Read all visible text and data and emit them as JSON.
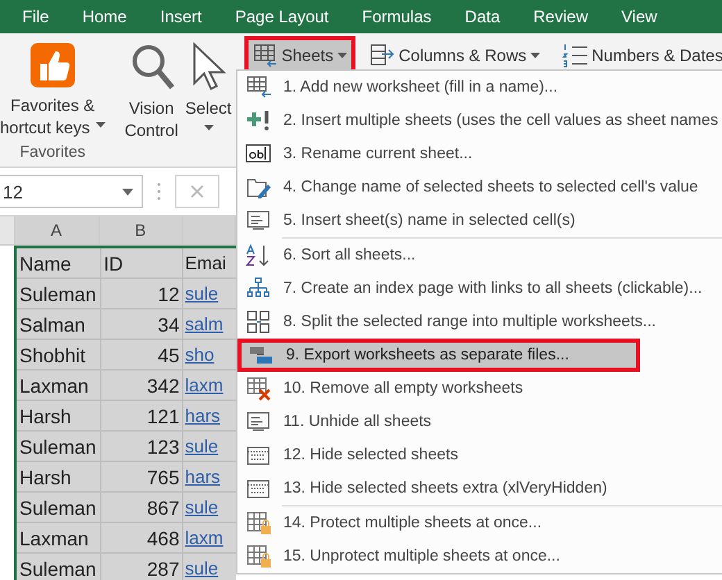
{
  "ribbon_tabs": [
    {
      "label": "File",
      "selected": false
    },
    {
      "label": "Home",
      "selected": false
    },
    {
      "label": "Insert",
      "selected": false
    },
    {
      "label": "Page Layout",
      "selected": false
    },
    {
      "label": "Formulas",
      "selected": false
    },
    {
      "label": "Data",
      "selected": false
    },
    {
      "label": "Review",
      "selected": false
    },
    {
      "label": "View",
      "selected": false
    }
  ],
  "ribbon": {
    "favorites_button": {
      "label": "Favorites &",
      "label_line_2": "hortcut keys"
    },
    "vision_control": {
      "label": "Vision",
      "label_line_2": "Control"
    },
    "select_button": {
      "label": "Select"
    },
    "group_label": "Favorites",
    "toolbar": [
      {
        "label": "Sheets",
        "outlined": true,
        "open": true
      },
      {
        "label": "Columns & Rows",
        "outlined": false,
        "open": false
      },
      {
        "label": "Numbers & Dates",
        "outlined": false,
        "open": false
      }
    ]
  },
  "name_box": {
    "value": "12"
  },
  "sheet": {
    "columns": [
      "A",
      "B"
    ],
    "rows": [
      [
        "Name",
        "ID",
        "Emai"
      ],
      [
        "Suleman",
        "12",
        "sule"
      ],
      [
        "Salman",
        "34",
        "salm"
      ],
      [
        "Shobhit",
        "45",
        "sho"
      ],
      [
        "Laxman",
        "342",
        "laxm"
      ],
      [
        "Harsh",
        "121",
        "hars"
      ],
      [
        "Suleman",
        "123",
        "sule"
      ],
      [
        "Harsh",
        "765",
        "hars"
      ],
      [
        "Suleman",
        "867",
        "sule"
      ],
      [
        "Laxman",
        "468",
        "laxm"
      ],
      [
        "Suleman",
        "287",
        "sule"
      ]
    ]
  },
  "menu": {
    "sections": [
      [
        {
          "label": "1. Add new worksheet (fill in a name)...",
          "selected": false,
          "outlined": false
        },
        {
          "label": "2. Insert multiple sheets (uses the cell values as sheet names",
          "selected": false,
          "outlined": false
        },
        {
          "label": "3. Rename current sheet...",
          "selected": false,
          "outlined": false
        },
        {
          "label": "4. Change name of selected sheets to selected cell's value",
          "selected": false,
          "outlined": false
        },
        {
          "label": "5. Insert sheet(s) name in selected cell(s)",
          "selected": false,
          "outlined": false
        }
      ],
      [
        {
          "label": "6. Sort all sheets...",
          "selected": false,
          "outlined": false
        },
        {
          "label": "7. Create an index page with links to all sheets (clickable)...",
          "selected": false,
          "outlined": false
        },
        {
          "label": "8. Split the selected range into multiple worksheets...",
          "selected": false,
          "outlined": false
        },
        {
          "label": "9. Export worksheets as separate files...",
          "selected": true,
          "outlined": true
        },
        {
          "label": "10. Remove all empty worksheets",
          "selected": false,
          "outlined": false
        },
        {
          "label": "11. Unhide all sheets",
          "selected": false,
          "outlined": false
        },
        {
          "label": "12. Hide selected sheets",
          "selected": false,
          "outlined": false
        },
        {
          "label": "13. Hide selected sheets extra (xlVeryHidden)",
          "selected": false,
          "outlined": false
        }
      ],
      [
        {
          "label": "14. Protect multiple sheets at once...",
          "selected": false,
          "outlined": false
        },
        {
          "label": "15. Unprotect multiple sheets at once...",
          "selected": false,
          "outlined": false
        }
      ]
    ]
  }
}
